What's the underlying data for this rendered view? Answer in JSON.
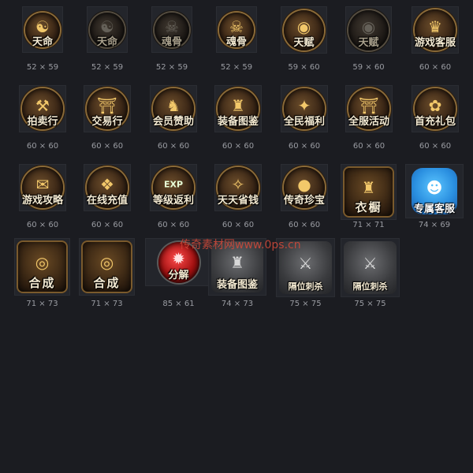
{
  "watermark": "传奇素材网www.0ps.cn",
  "icons": [
    {
      "label": "天命",
      "size": "52 × 59",
      "glyph": "☯",
      "variant": "bright",
      "icon": "yin-yang-icon"
    },
    {
      "label": "天命",
      "size": "52 × 59",
      "glyph": "☯",
      "variant": "dim",
      "icon": "yin-yang-icon"
    },
    {
      "label": "魂骨",
      "size": "52 × 59",
      "glyph": "☠",
      "variant": "dim",
      "icon": "skull-crest-icon"
    },
    {
      "label": "魂骨",
      "size": "52 × 59",
      "glyph": "☠",
      "variant": "bright",
      "icon": "skull-crest-icon"
    },
    {
      "label": "天赋",
      "size": "59 × 60",
      "glyph": "◉",
      "variant": "bright",
      "icon": "talent-orb-icon"
    },
    {
      "label": "天赋",
      "size": "59 × 60",
      "glyph": "◉",
      "variant": "dim",
      "icon": "talent-orb-icon"
    },
    {
      "label": "游戏客服",
      "size": "60 × 60",
      "glyph": "♛",
      "variant": "bright",
      "icon": "lady-portrait-icon"
    },
    {
      "label": "拍卖行",
      "size": "60 × 60",
      "glyph": "⚒",
      "variant": "bright",
      "icon": "gavel-icon"
    },
    {
      "label": "交易行",
      "size": "60 × 60",
      "glyph": "⛩",
      "variant": "bright",
      "icon": "pavilion-icon"
    },
    {
      "label": "会员赞助",
      "size": "60 × 60",
      "glyph": "♞",
      "variant": "bright",
      "icon": "golden-mask-icon"
    },
    {
      "label": "装备图鉴",
      "size": "60 × 60",
      "glyph": "♜",
      "variant": "bright",
      "icon": "armor-crest-icon"
    },
    {
      "label": "全民福利",
      "size": "60 × 60",
      "glyph": "✦",
      "variant": "bright",
      "icon": "treasure-chest-icon"
    },
    {
      "label": "全服活动",
      "size": "60 × 60",
      "glyph": "⛩",
      "variant": "bright",
      "icon": "gate-icon"
    },
    {
      "label": "首充礼包",
      "size": "60 × 60",
      "glyph": "✿",
      "variant": "bright",
      "icon": "dragon-pot-icon"
    },
    {
      "label": "游戏攻略",
      "size": "60 × 60",
      "glyph": "✉",
      "variant": "bright",
      "icon": "scroll-icon"
    },
    {
      "label": "在线充值",
      "size": "60 × 60",
      "glyph": "❖",
      "variant": "bright",
      "icon": "gold-pile-icon"
    },
    {
      "label": "等级返利",
      "size": "60 × 60",
      "glyph": "EXP",
      "variant": "bright",
      "icon": "exp-potion-icon"
    },
    {
      "label": "天天省钱",
      "size": "60 × 60",
      "glyph": "✧",
      "variant": "bright",
      "icon": "gold-chest-icon"
    },
    {
      "label": "传奇珍宝",
      "size": "60 × 60",
      "glyph": "●",
      "variant": "bright",
      "icon": "ruby-orb-icon"
    },
    {
      "label": "衣橱",
      "size": "71 × 71",
      "glyph": "♜",
      "variant": "tall",
      "icon": "golden-armor-icon"
    },
    {
      "label": "专属客服",
      "size": "74 × 69",
      "glyph": "☻",
      "variant": "blue",
      "icon": "blue-mascot-icon"
    },
    {
      "label": "合成",
      "size": "71 × 73",
      "glyph": "◎",
      "variant": "tall",
      "icon": "synthesis-orb-icon"
    },
    {
      "label": "合成",
      "size": "71 × 73",
      "glyph": "◎",
      "variant": "tall",
      "icon": "synthesis-orb-icon"
    },
    {
      "label": "分解",
      "size": "85 × 61",
      "glyph": "✹",
      "variant": "red",
      "icon": "decompose-gem-icon"
    },
    {
      "label": "装备图鉴",
      "size": "74 × 73",
      "glyph": "♜",
      "variant": "grey",
      "icon": "armor-catalog-icon"
    },
    {
      "label": "隔位刺杀",
      "size": "75 × 75",
      "glyph": "⚔",
      "variant": "greysmall",
      "icon": "sword-emblem-icon"
    },
    {
      "label": "隔位刺杀",
      "size": "75 × 75",
      "glyph": "⚔",
      "variant": "greysmall",
      "icon": "sword-emblem-icon"
    }
  ]
}
